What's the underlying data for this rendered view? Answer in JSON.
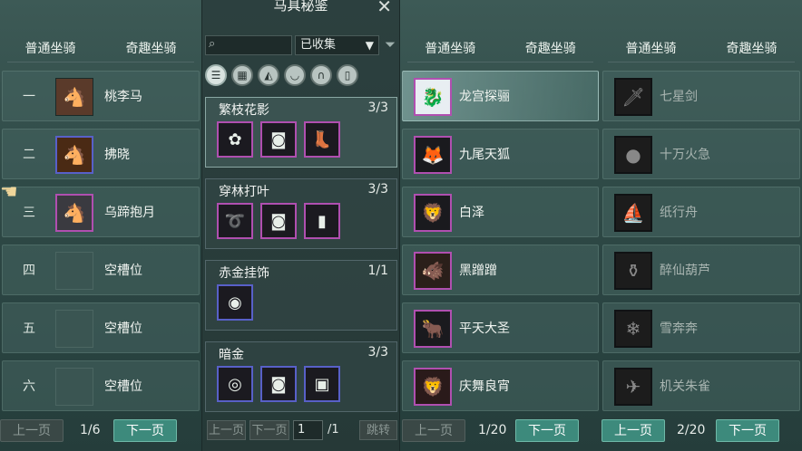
{
  "panel1": {
    "tabs": [
      "普通坐骑",
      "奇趣坐骑"
    ],
    "rows": [
      {
        "num": "一",
        "name": "桃李马",
        "icon": "horse-icon"
      },
      {
        "num": "二",
        "name": "拂晓",
        "icon": "horse-icon"
      },
      {
        "num": "三",
        "name": "乌蹄抱月",
        "icon": "horse-icon"
      },
      {
        "num": "四",
        "name": "空槽位",
        "icon": "empty-slot-icon"
      },
      {
        "num": "五",
        "name": "空槽位",
        "icon": "empty-slot-icon"
      },
      {
        "num": "六",
        "name": "空槽位",
        "icon": "empty-slot-icon"
      }
    ],
    "prev": "上一页",
    "page": "1/6",
    "next": "下一页"
  },
  "panel2": {
    "title": "马具秘鉴",
    "filter_value": "已收集",
    "sets": [
      {
        "name": "繁枝花影",
        "count": "3/3"
      },
      {
        "name": "穿林打叶",
        "count": "3/3"
      },
      {
        "name": "赤金挂饰",
        "count": "1/1"
      },
      {
        "name": "暗金",
        "count": "3/3"
      }
    ],
    "prev": "上一页",
    "next": "下一页",
    "page_input": "1",
    "page_total": "/1",
    "jump": "跳转"
  },
  "panel3": {
    "tabs": [
      "普通坐骑",
      "奇趣坐骑"
    ],
    "rows": [
      {
        "name": "龙宫探骊"
      },
      {
        "name": "九尾天狐"
      },
      {
        "name": "白泽"
      },
      {
        "name": "黑蹭蹭"
      },
      {
        "name": "平天大圣"
      },
      {
        "name": "庆舞良宵"
      }
    ],
    "prev": "上一页",
    "page": "1/20",
    "next": "下一页"
  },
  "panel4": {
    "tabs": [
      "普通坐骑",
      "奇趣坐骑"
    ],
    "rows": [
      {
        "name": "七星剑"
      },
      {
        "name": "十万火急"
      },
      {
        "name": "纸行舟"
      },
      {
        "name": "醉仙葫芦"
      },
      {
        "name": "雪奔奔"
      },
      {
        "name": "机关朱雀"
      }
    ],
    "prev": "上一页",
    "page": "2/20",
    "next": "下一页"
  }
}
